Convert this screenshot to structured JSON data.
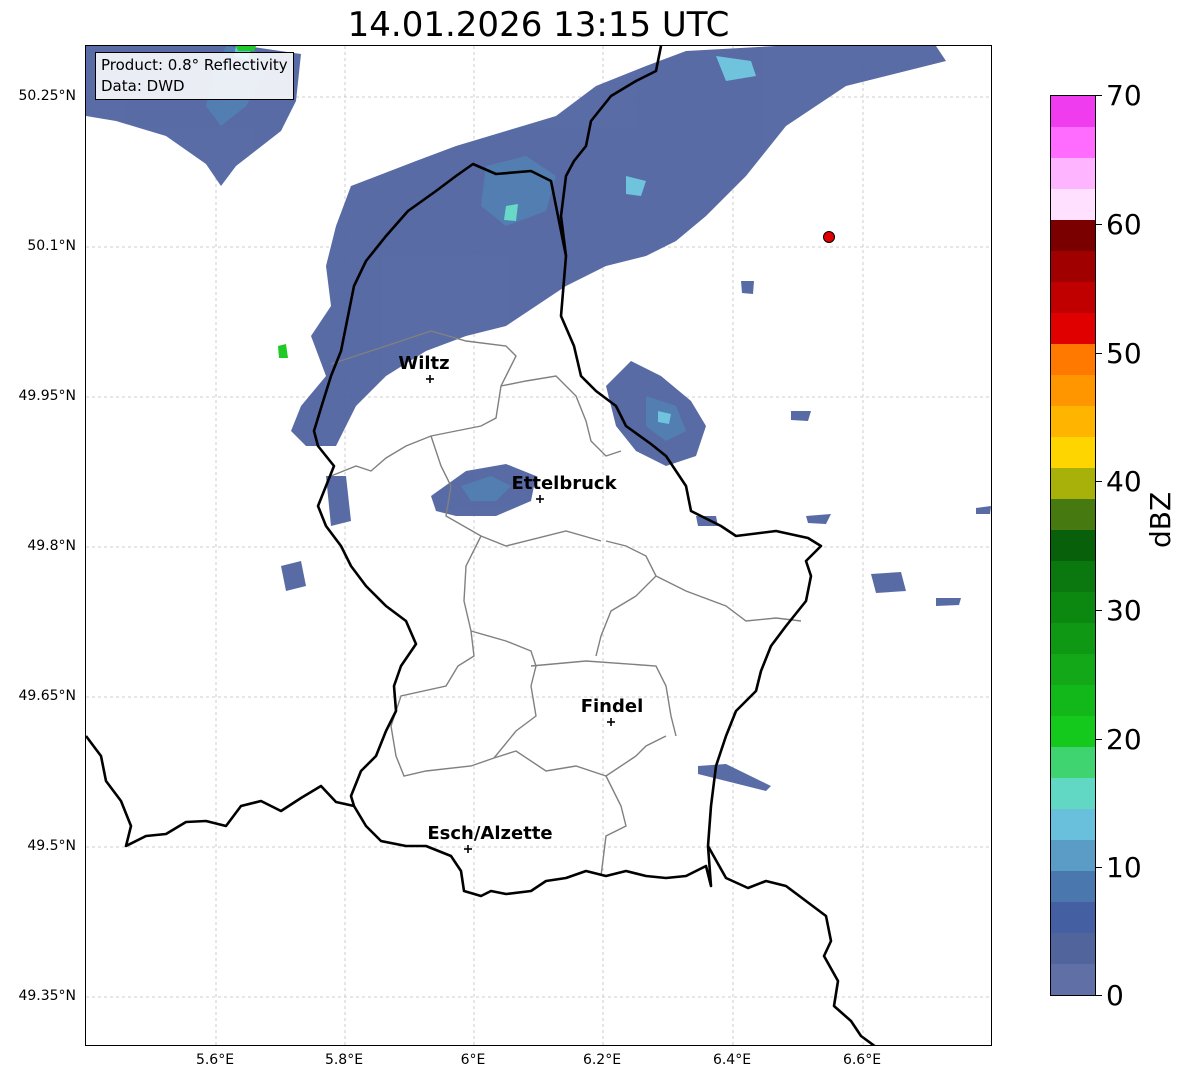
{
  "title": "14.01.2026 13:15 UTC",
  "info": {
    "product": "Product: 0.8° Reflectivity",
    "data": "Data: DWD"
  },
  "axes": {
    "lat_labels": [
      "50.25°N",
      "50.1°N",
      "49.95°N",
      "49.8°N",
      "49.65°N",
      "49.5°N",
      "49.35°N"
    ],
    "lon_labels": [
      "5.6°E",
      "5.8°E",
      "6°E",
      "6.2°E",
      "6.4°E",
      "6.6°E"
    ]
  },
  "cities": [
    {
      "name": "Wiltz"
    },
    {
      "name": "Ettelbruck"
    },
    {
      "name": "Findel"
    },
    {
      "name": "Esch/Alzette"
    }
  ],
  "colorbar": {
    "unit": "dBZ",
    "tick_labels": [
      "0",
      "10",
      "20",
      "30",
      "40",
      "50",
      "60",
      "70"
    ],
    "colors": [
      "#6070a6",
      "#52649c",
      "#4460a2",
      "#4a78ae",
      "#5a9cc6",
      "#68c0dc",
      "#60d8c4",
      "#40d470",
      "#14c81c",
      "#12b81a",
      "#12a818",
      "#0f9814",
      "#0c8811",
      "#0a780e",
      "#08600b",
      "#467a10",
      "#a8b00a",
      "#ffd500",
      "#ffb500",
      "#ff9600",
      "#ff7800",
      "#e00000",
      "#c00000",
      "#a00000",
      "#7a0000",
      "#ffe0ff",
      "#ffb4ff",
      "#ff6cff",
      "#ee3cee"
    ]
  },
  "colors": {
    "precip_light": "#5064a0",
    "precip_mid": "#4a78ae",
    "precip_cyan": "#60d8c4",
    "precip_green": "#14c81c",
    "border": "#000000",
    "canton": "#808080",
    "marker": "#e00000"
  }
}
